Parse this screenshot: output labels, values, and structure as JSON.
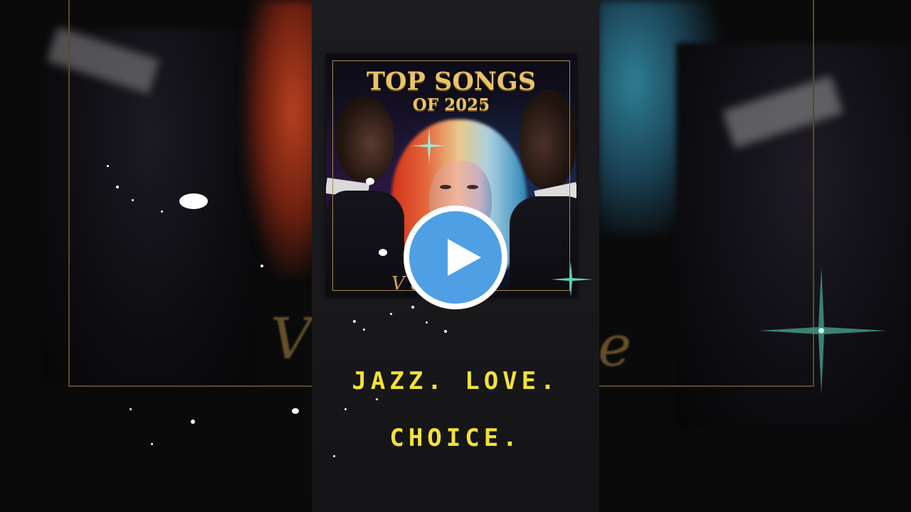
{
  "video": {
    "cover": {
      "title_line1": "TOP SONGS",
      "title_line2": "OF 2025",
      "signature": "V       a"
    },
    "tagline_line1": "JAZZ. LOVE.",
    "tagline_line2": "CHOICE.",
    "background_script_left": "V",
    "background_script_right": "e",
    "play_icon": "play-icon",
    "colors": {
      "play_button_fill": "#4f9fe4",
      "tagline": "#f2e23a",
      "cover_title": "#e8c36a",
      "frame_gold": "#a8894a"
    }
  }
}
